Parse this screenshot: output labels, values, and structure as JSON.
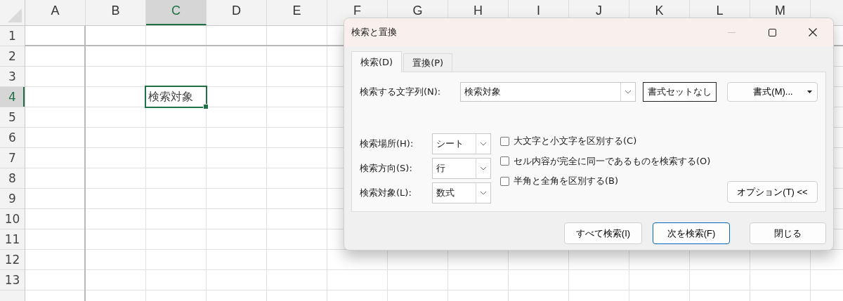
{
  "spreadsheet": {
    "columns": [
      {
        "label": "A",
        "selected": false
      },
      {
        "label": "B",
        "selected": false
      },
      {
        "label": "C",
        "selected": true
      },
      {
        "label": "D",
        "selected": false
      },
      {
        "label": "E",
        "selected": false
      },
      {
        "label": "F",
        "selected": false
      },
      {
        "label": "G",
        "selected": false
      },
      {
        "label": "H",
        "selected": false
      },
      {
        "label": "I",
        "selected": false
      },
      {
        "label": "J",
        "selected": false
      },
      {
        "label": "K",
        "selected": false
      },
      {
        "label": "L",
        "selected": false
      },
      {
        "label": "M",
        "selected": false
      }
    ],
    "rows": [
      {
        "label": "1",
        "selected": false
      },
      {
        "label": "2",
        "selected": false
      },
      {
        "label": "3",
        "selected": false
      },
      {
        "label": "4",
        "selected": true
      },
      {
        "label": "5",
        "selected": false
      },
      {
        "label": "6",
        "selected": false
      },
      {
        "label": "7",
        "selected": false
      },
      {
        "label": "8",
        "selected": false
      },
      {
        "label": "9",
        "selected": false
      },
      {
        "label": "10",
        "selected": false
      },
      {
        "label": "11",
        "selected": false
      },
      {
        "label": "12",
        "selected": false
      },
      {
        "label": "13",
        "selected": false
      }
    ],
    "active_cell": {
      "value": "検索対象"
    }
  },
  "dialog": {
    "title": "検索と置換",
    "tabs": [
      {
        "label": "検索(D)",
        "selected": true
      },
      {
        "label": "置換(P)",
        "selected": false
      }
    ],
    "find_what": {
      "label": "検索する文字列(N):",
      "value": "検索対象"
    },
    "format_preview": {
      "label": "書式セットなし"
    },
    "format_button": {
      "label": "書式(M)..."
    },
    "dropdowns": [
      {
        "label": "検索場所(H):",
        "value": "シート"
      },
      {
        "label": "検索方向(S):",
        "value": "行"
      },
      {
        "label": "検索対象(L):",
        "value": "数式"
      }
    ],
    "checkboxes": [
      {
        "label": "大文字と小文字を区別する(C)",
        "checked": false
      },
      {
        "label": "セル内容が完全に同一であるものを検索する(O)",
        "checked": false
      },
      {
        "label": "半角と全角を区別する(B)",
        "checked": false
      }
    ],
    "options_button": {
      "label": "オプション(T) <<"
    },
    "buttons": [
      {
        "label": "すべて検索(I)",
        "default": false
      },
      {
        "label": "次を検索(F)",
        "default": true
      },
      {
        "label": "閉じる",
        "default": false
      }
    ]
  }
}
